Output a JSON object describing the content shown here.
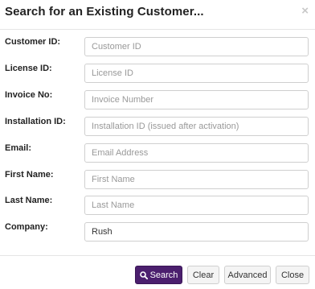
{
  "dialog": {
    "title": "Search for an Existing Customer...",
    "close_glyph": "×"
  },
  "fields": [
    {
      "label": "Customer ID:",
      "placeholder": "Customer ID",
      "value": ""
    },
    {
      "label": "License ID:",
      "placeholder": "License ID",
      "value": ""
    },
    {
      "label": "Invoice No:",
      "placeholder": "Invoice Number",
      "value": ""
    },
    {
      "label": "Installation ID:",
      "placeholder": "Installation ID (issued after activation)",
      "value": ""
    },
    {
      "label": "Email:",
      "placeholder": "Email Address",
      "value": ""
    },
    {
      "label": "First Name:",
      "placeholder": "First Name",
      "value": ""
    },
    {
      "label": "Last Name:",
      "placeholder": "Last Name",
      "value": ""
    },
    {
      "label": "Company:",
      "placeholder": "",
      "value": "Rush"
    }
  ],
  "buttons": {
    "search": "Search",
    "clear": "Clear",
    "advanced": "Advanced",
    "close": "Close"
  },
  "icons": {
    "search": "search-icon"
  },
  "colors": {
    "primary": "#4b1f6e",
    "close_x": "#c8c8c8"
  }
}
